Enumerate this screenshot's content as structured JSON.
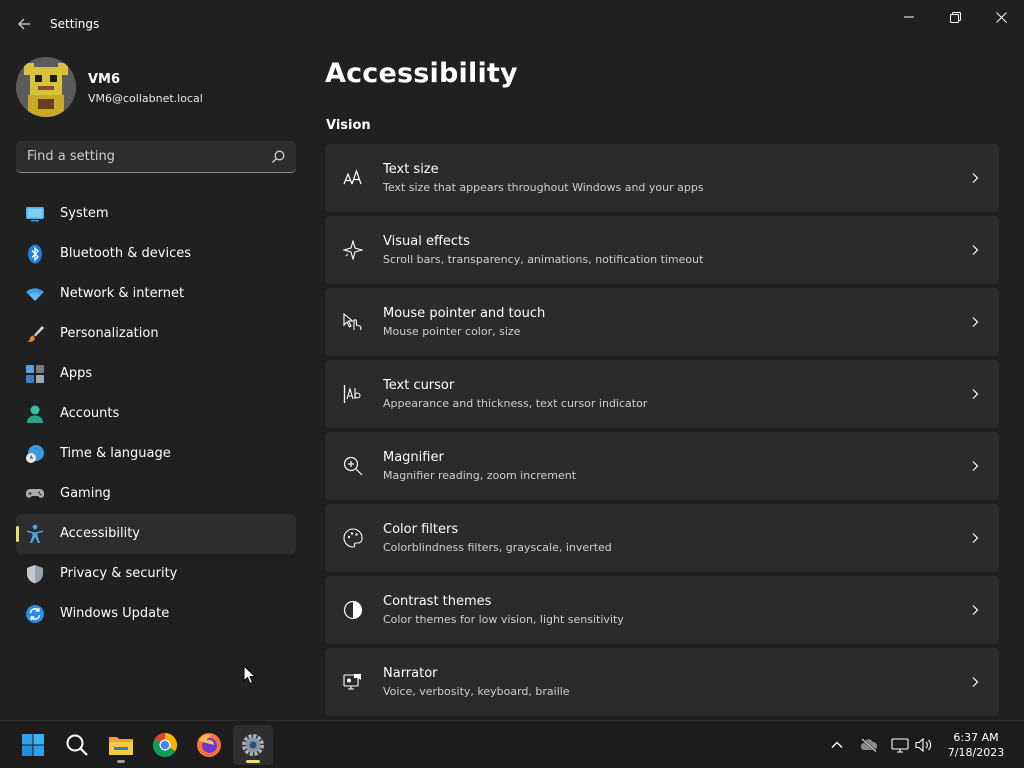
{
  "window": {
    "title": "Settings"
  },
  "user": {
    "name": "VM6",
    "email": "VM6@collabnet.local"
  },
  "search": {
    "placeholder": "Find a setting"
  },
  "nav": {
    "items": [
      {
        "label": "System",
        "icon": "system-icon"
      },
      {
        "label": "Bluetooth & devices",
        "icon": "bluetooth-icon"
      },
      {
        "label": "Network & internet",
        "icon": "wifi-icon"
      },
      {
        "label": "Personalization",
        "icon": "brush-icon"
      },
      {
        "label": "Apps",
        "icon": "apps-icon"
      },
      {
        "label": "Accounts",
        "icon": "person-icon"
      },
      {
        "label": "Time & language",
        "icon": "globe-clock-icon"
      },
      {
        "label": "Gaming",
        "icon": "gamepad-icon"
      },
      {
        "label": "Accessibility",
        "icon": "accessibility-icon",
        "active": true
      },
      {
        "label": "Privacy & security",
        "icon": "shield-icon"
      },
      {
        "label": "Windows Update",
        "icon": "update-icon"
      }
    ]
  },
  "main": {
    "title": "Accessibility",
    "section": "Vision",
    "cards": [
      {
        "title": "Text size",
        "subtitle": "Text size that appears throughout Windows and your apps",
        "icon": "text-size-icon"
      },
      {
        "title": "Visual effects",
        "subtitle": "Scroll bars, transparency, animations, notification timeout",
        "icon": "sparkle-icon"
      },
      {
        "title": "Mouse pointer and touch",
        "subtitle": "Mouse pointer color, size",
        "icon": "pointer-touch-icon"
      },
      {
        "title": "Text cursor",
        "subtitle": "Appearance and thickness, text cursor indicator",
        "icon": "text-cursor-icon"
      },
      {
        "title": "Magnifier",
        "subtitle": "Magnifier reading, zoom increment",
        "icon": "magnifier-icon"
      },
      {
        "title": "Color filters",
        "subtitle": "Colorblindness filters, grayscale, inverted",
        "icon": "palette-icon"
      },
      {
        "title": "Contrast themes",
        "subtitle": "Color themes for low vision, light sensitivity",
        "icon": "contrast-icon"
      },
      {
        "title": "Narrator",
        "subtitle": "Voice, verbosity, keyboard, braille",
        "icon": "narrator-icon"
      }
    ]
  },
  "taskbar": {
    "apps": [
      "start-icon",
      "search-icon",
      "file-explorer-icon",
      "chrome-icon",
      "firefox-icon",
      "settings-icon"
    ],
    "clock": {
      "time": "6:37 AM",
      "date": "7/18/2023"
    }
  },
  "colors": {
    "background": "#202020",
    "card": "#2b2b2b",
    "accent": "#e3e06b",
    "taskbar": "#1c1c1c"
  }
}
